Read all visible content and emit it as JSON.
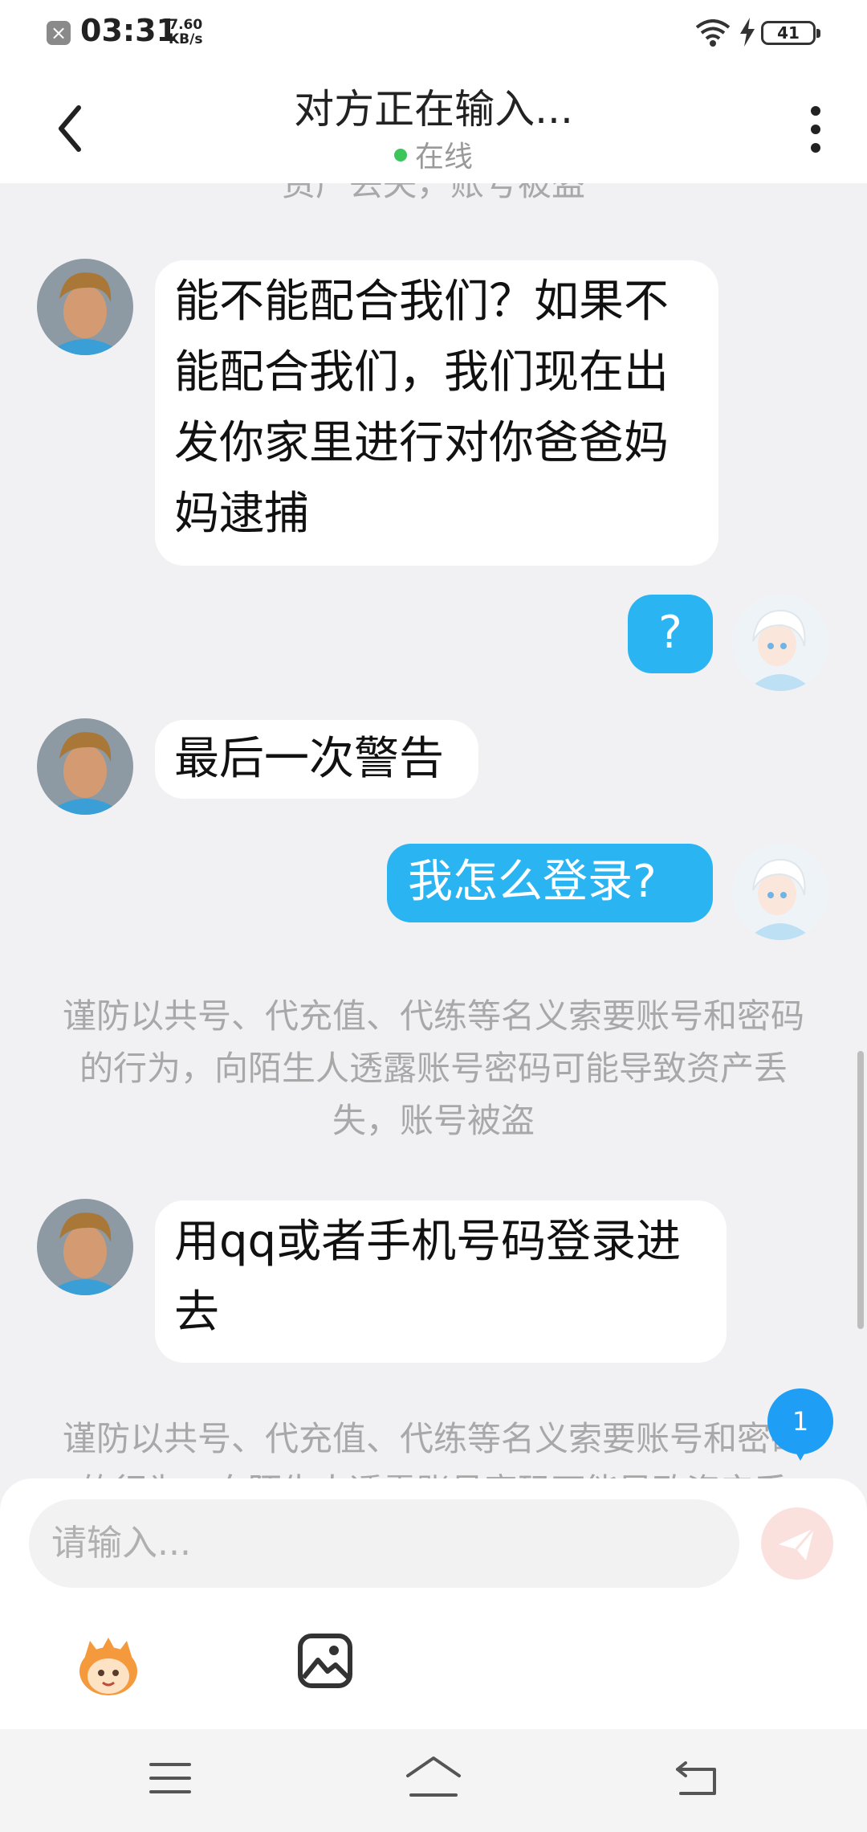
{
  "status_bar": {
    "time": "03:31",
    "speed_value": "7.60",
    "speed_unit": "KB/s",
    "battery": "41"
  },
  "header": {
    "title": "对方正在输入...",
    "status": "在线"
  },
  "chat": {
    "top_partial_notice": "资产丢失，账号被盗",
    "messages": [
      {
        "from": "other",
        "text": "能不能配合我们？如果不能配合我们，我们现在出发你家里进行对你爸爸妈妈逮捕"
      },
      {
        "from": "me",
        "text": "?"
      },
      {
        "from": "other",
        "text": "最后一次警告"
      },
      {
        "from": "me",
        "text": "我怎么登录?"
      },
      {
        "from": "system",
        "text": "谨防以共号、代充值、代练等名义索要账号和密码的行为，向陌生人透露账号密码可能导致资产丢失，账号被盗"
      },
      {
        "from": "other",
        "text": "用qq或者手机号码登录进去"
      },
      {
        "from": "system",
        "text": "谨防以共号、代充值、代练等名义索要账号和密码的行为，向陌生人透露账号密码可能导致资产丢失，账号被盗"
      }
    ],
    "unread_badge": "1"
  },
  "input": {
    "placeholder": "请输入..."
  },
  "colors": {
    "accent": "#2bb4f2",
    "badge": "#1e9ef4",
    "online": "#3cc55a",
    "send": "#fbe1de"
  },
  "icons": [
    "back-icon",
    "more-icon",
    "send-icon",
    "emoji-icon",
    "image-icon",
    "menu-icon",
    "home-icon",
    "nav-back-icon"
  ]
}
